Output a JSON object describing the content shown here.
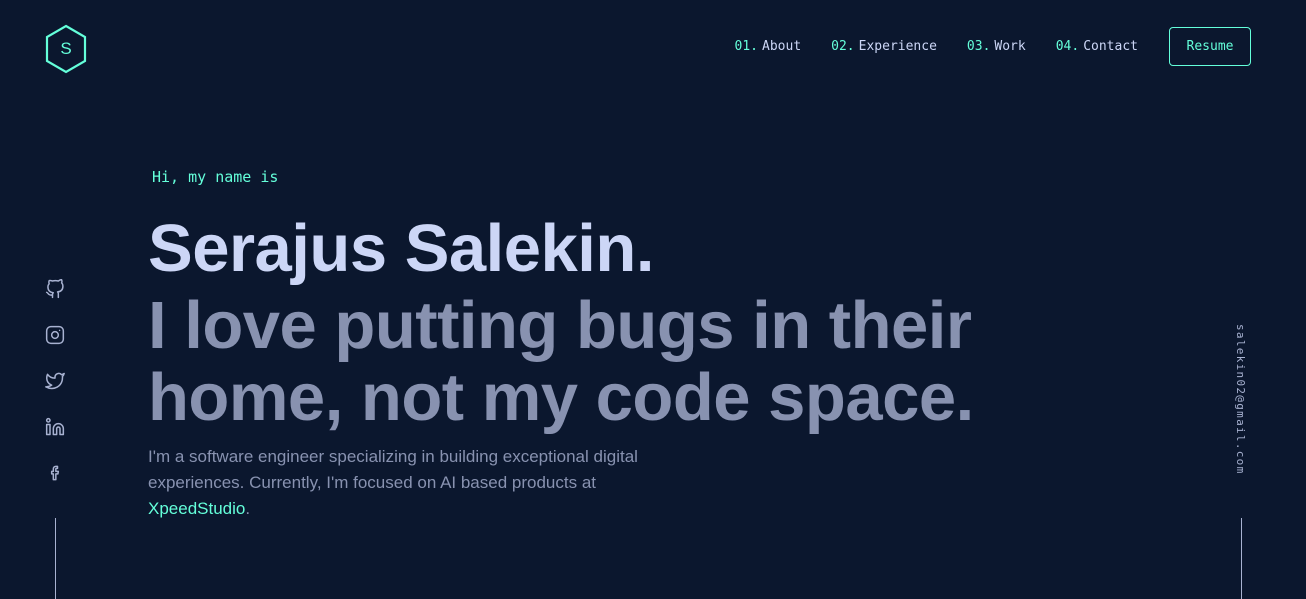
{
  "logo": {
    "letter": "S"
  },
  "nav": {
    "items": [
      {
        "num": "01.",
        "label": "About"
      },
      {
        "num": "02.",
        "label": "Experience"
      },
      {
        "num": "03.",
        "label": "Work"
      },
      {
        "num": "04.",
        "label": "Contact"
      }
    ],
    "resume_label": "Resume"
  },
  "social": [
    "github-icon",
    "instagram-icon",
    "twitter-icon",
    "linkedin-icon",
    "facebook-icon"
  ],
  "email": "salekin02@gmail.com",
  "hero": {
    "greeting": "Hi, my name is",
    "name": "Serajus Salekin.",
    "tagline": "I love putting bugs in their home, not my code space.",
    "bio_text": "I'm a software engineer specializing in building exceptional digital experiences. Currently, I'm focused on AI based products at ",
    "bio_link": "XpeedStudio",
    "bio_end": "."
  },
  "colors": {
    "background": "#0b172e",
    "accent": "#64ffda",
    "heading": "#ccd6f6",
    "text": "#8892b0"
  }
}
